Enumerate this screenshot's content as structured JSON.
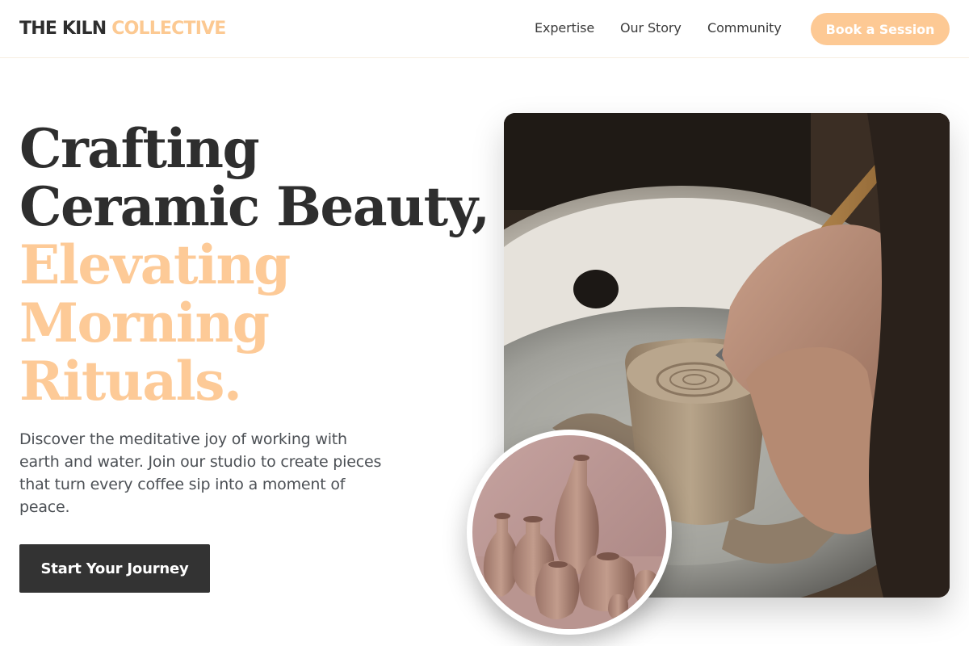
{
  "brand": {
    "name_primary": "THE KILN",
    "name_accent": "COLLECTIVE",
    "accent_color": "#fdc994",
    "dark_color": "#333333"
  },
  "nav": {
    "items": [
      {
        "label": "Expertise"
      },
      {
        "label": "Our Story"
      },
      {
        "label": "Community"
      }
    ],
    "cta_label": "Book a Session"
  },
  "hero": {
    "headline_dark": [
      "Crafting",
      "Ceramic Beauty,"
    ],
    "headline_accent": [
      "Elevating",
      "Morning",
      "Rituals."
    ],
    "description": "Discover the meditative joy of working with earth and water. Join our studio to create pieces that turn every coffee sip into a moment of peace.",
    "cta_label": "Start Your Journey",
    "main_image": {
      "icon": "pottery-wheel-photo"
    },
    "inset_image": {
      "icon": "clay-vases-photo"
    }
  }
}
